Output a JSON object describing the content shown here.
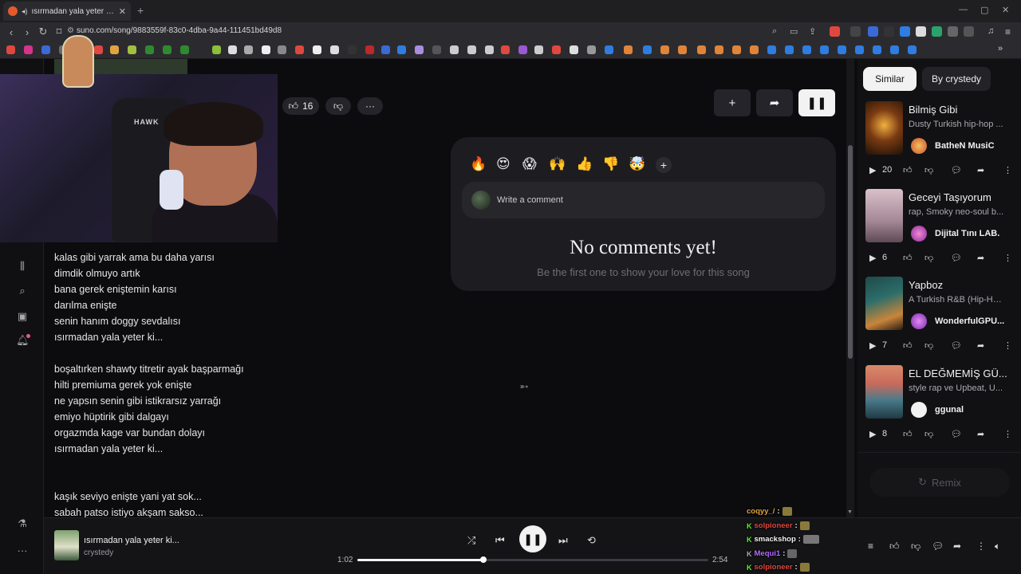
{
  "browser": {
    "tab_title": "ısırmadan yala yeter ki... by crystedy",
    "url": "suno.com/song/9883559f-83c0-4dba-9a44-111451bd49d8"
  },
  "song": {
    "likes": "16"
  },
  "lyrics": [
    "kalas gibi yarrak ama bu daha yarısı",
    "dimdik olmuyo artık",
    "bana gerek eniştemin karısı",
    "darılma enişte",
    "senin hanım doggy sevdalısı",
    "ısırmadan yala yeter ki...",
    "",
    "boşaltırken shawty titretir ayak başparmağı",
    "hilti premiuma gerek yok enişte",
    "ne yapsın senin gibi istikrarsız yarrağı",
    "emiyo hüptirik gibi dalgayı",
    "orgazmda kage var bundan dolayı",
    "ısırmadan yala yeter ki...",
    "",
    "",
    "kaşık seviyo enişte yani yat sok...",
    "sabah patso istiyo akşam sakso..."
  ],
  "comments": {
    "placeholder": "Write a comment",
    "empty_title": "No comments yet!",
    "empty_subtitle": "Be the first one to show your love for this song",
    "emojis": [
      "🔥",
      "😍",
      "😱",
      "🙌",
      "👍",
      "👎",
      "🤯",
      "+"
    ]
  },
  "right_panel": {
    "tabs": [
      "Similar",
      "By crystedy"
    ],
    "songs": [
      {
        "title": "Bilmiş Gibi",
        "desc": "Dusty Turkish hip-hop ...",
        "artist": "BatheN MusiC",
        "plays": "20",
        "thumb_color": "#b57a2c",
        "avatar_color": "#e07a3a"
      },
      {
        "title": "Geceyi Taşıyorum",
        "desc": "rap, Smoky neo-soul b...",
        "artist": "Dijital Tını LAB.",
        "plays": "6",
        "thumb_color": "#c9a9b8",
        "avatar_color": "#c44fb3"
      },
      {
        "title": "Yapboz",
        "desc": "A Turkish R&B (Hip-Ho...",
        "artist": "WonderfulGPU...",
        "plays": "7",
        "thumb_color": "#2f5a5a",
        "avatar_color": "#a339c9"
      },
      {
        "title": "EL DEĞMEMİŞ GÜ...",
        "desc": "style rap ve Upbeat, U...",
        "artist": "ggunal",
        "plays": "8",
        "thumb_color": "#d58a6a",
        "avatar_color": "#f2f2f2"
      }
    ],
    "remix_label": "Remix"
  },
  "player": {
    "title": "ısırmadan yala yeter ki...",
    "artist": "crystedy",
    "current_time": "1:02",
    "total_time": "2:54",
    "progress": 0.36
  },
  "webcam": {
    "brand_text": "HAWK"
  },
  "chat": [
    {
      "user": "coqyy_/",
      "color": "#e0a340",
      "badge": ""
    },
    {
      "user": "solpioneer",
      "color": "#e0483f",
      "badge": "K"
    },
    {
      "user": "smackshop",
      "color": "#f2f2f2",
      "badge": "K"
    },
    {
      "user": "Mequi1",
      "color": "#b46bff",
      "badge": "K"
    },
    {
      "user": "solpioneer",
      "color": "#e0483f",
      "badge": "K"
    }
  ]
}
